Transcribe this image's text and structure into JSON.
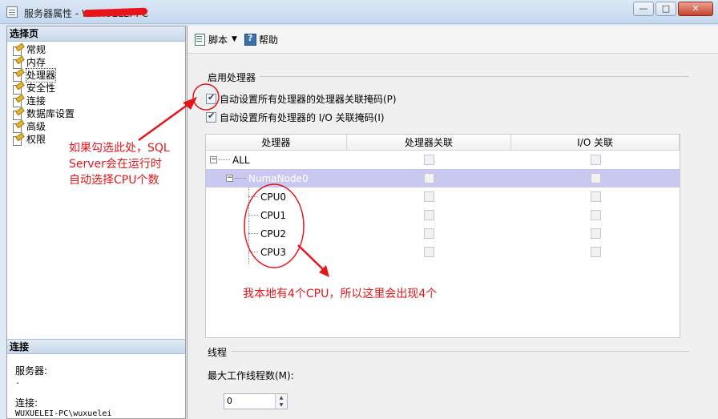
{
  "window": {
    "title": "服务器属性 - WUXUELEI-PC",
    "minimize": "—",
    "maximize": "□",
    "close": "✕"
  },
  "left": {
    "select_page_header": "选择页",
    "pages": [
      {
        "label": "常规",
        "icon": "page-settings-icon"
      },
      {
        "label": "内存",
        "icon": "page-settings-icon"
      },
      {
        "label": "处理器",
        "icon": "page-settings-icon",
        "selected": true
      },
      {
        "label": "安全性",
        "icon": "page-settings-icon"
      },
      {
        "label": "连接",
        "icon": "page-settings-icon"
      },
      {
        "label": "数据库设置",
        "icon": "page-settings-icon"
      },
      {
        "label": "高级",
        "icon": "page-settings-icon"
      },
      {
        "label": "权限",
        "icon": "page-settings-icon"
      }
    ],
    "connection_header": "连接",
    "server_label": "服务器:",
    "server_value": ".",
    "connection_label": "连接:",
    "connection_value": "WUXUELEI-PC\\wuxuelei"
  },
  "toolbar": {
    "script_label": "脚本",
    "help_label": "帮助"
  },
  "processor": {
    "group_label": "启用处理器",
    "auto_affinity_label": "自动设置所有处理器的处理器关联掩码(P)",
    "auto_affinity_checked": true,
    "auto_io_label": "自动设置所有处理器的 I/O 关联掩码(I)",
    "auto_io_checked": true,
    "grid": {
      "columns": [
        "处理器",
        "处理器关联",
        "I/O 关联"
      ],
      "rows": [
        {
          "name": "ALL",
          "level": 0,
          "toggle": "−"
        },
        {
          "name": "NumaNode0",
          "level": 1,
          "toggle": "−",
          "selected": true
        },
        {
          "name": "CPU0",
          "level": 2
        },
        {
          "name": "CPU1",
          "level": 2
        },
        {
          "name": "CPU2",
          "level": 2
        },
        {
          "name": "CPU3",
          "level": 2
        }
      ]
    }
  },
  "threads": {
    "group_label": "线程",
    "max_worker_label": "最大工作线程数(M):",
    "max_worker_value": "0"
  },
  "annotations": {
    "note1_line1": "如果勾选此处，SQL",
    "note1_line2": "Server会在运行时",
    "note1_line3": "自动选择CPU个数",
    "note2": "我本地有4个CPU，所以这里会出现4个",
    "color": "#e4161b"
  }
}
